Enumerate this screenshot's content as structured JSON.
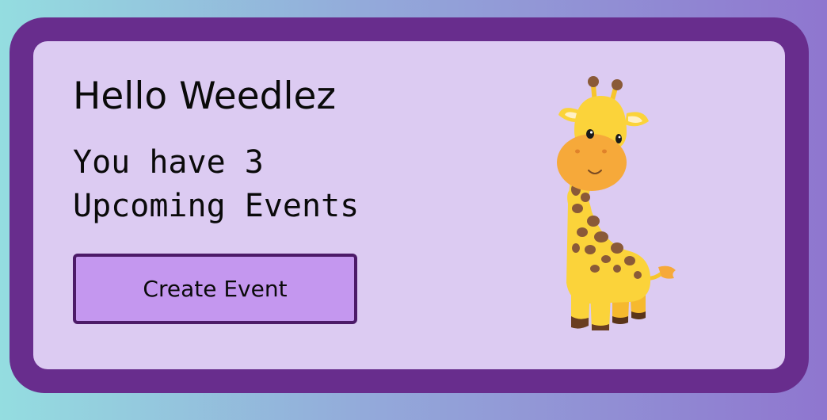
{
  "card": {
    "greeting": "Hello Weedlez",
    "subtitle": "You have 3 Upcoming Events",
    "create_button_label": "Create Event"
  },
  "illustration": {
    "icon": "giraffe-illustration"
  },
  "colors": {
    "frame": "#682d8d",
    "card_background": "#dccbf2",
    "button_background": "#c497ef",
    "button_border": "#4c1a68"
  }
}
